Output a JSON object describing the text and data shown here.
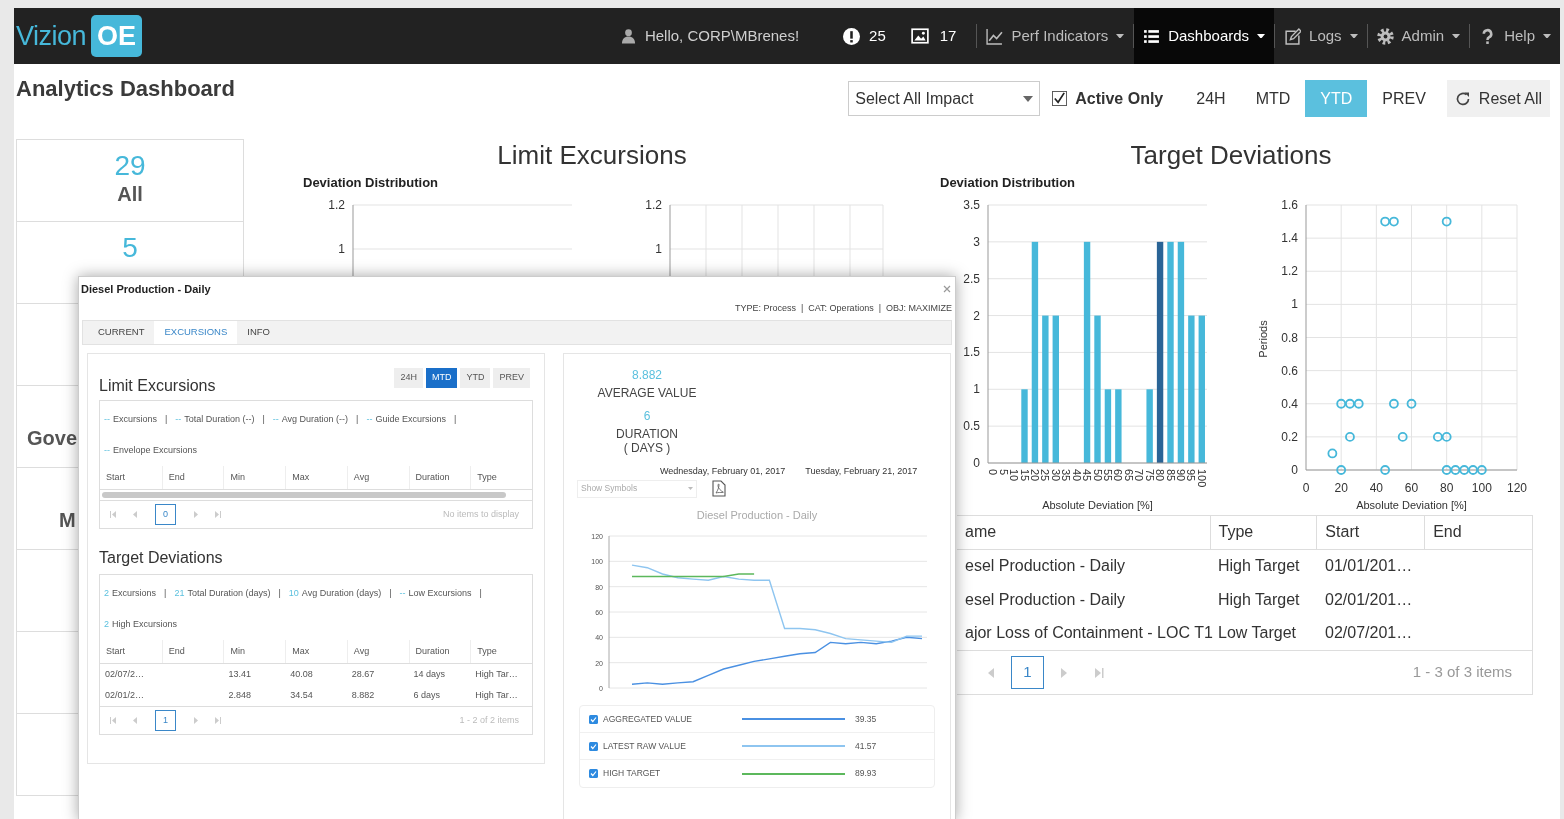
{
  "navbar": {
    "logo": {
      "text": "Vizion",
      "badge": "OE"
    },
    "greeting": "Hello, CORP\\MBrenes!",
    "alert_count": "25",
    "image_count": "17",
    "menus": [
      {
        "label": "Perf Indicators",
        "kind": "chart",
        "active": false
      },
      {
        "label": "Dashboards",
        "kind": "list",
        "active": true
      },
      {
        "label": "Logs",
        "kind": "edit",
        "active": false
      },
      {
        "label": "Admin",
        "kind": "gear",
        "active": false
      },
      {
        "label": "Help",
        "kind": "help",
        "active": false
      }
    ]
  },
  "page_title": "Analytics Dashboard",
  "filters": {
    "impact_select": "Select All Impact",
    "active_only": {
      "label": "Active Only",
      "checked": true
    },
    "ranges": [
      {
        "label": "24H",
        "selected": false
      },
      {
        "label": "MTD",
        "selected": false
      },
      {
        "label": "YTD",
        "selected": true
      },
      {
        "label": "PREV",
        "selected": false
      }
    ],
    "reset": "Reset All"
  },
  "kpi_cards": [
    {
      "count": "29",
      "label": "All"
    },
    {
      "count": "5"
    },
    {
      "label": "Gove"
    },
    {
      "label": "M"
    }
  ],
  "limit_excursions": {
    "title": "Limit Excursions",
    "distribution_chart": {
      "title": "Deviation Distribution",
      "y_tick_labels": [
        "1.2",
        "1"
      ]
    },
    "chart_2": {
      "y_tick_labels": [
        "1.2",
        "1"
      ]
    }
  },
  "target_deviations": {
    "title": "Target Deviations",
    "distribution_chart": {
      "chart_data": {
        "type": "bar",
        "title": "Deviation Distribution",
        "xlabel": "Absolute Deviation [%]",
        "categories": [
          "0",
          "5",
          "10",
          "15",
          "20",
          "25",
          "30",
          "35",
          "40",
          "45",
          "50",
          "55",
          "60",
          "65",
          "70",
          "75",
          "80",
          "85",
          "90",
          "95",
          "100"
        ],
        "series": [
          {
            "color": "#46b8da",
            "values": [
              0,
              0,
              0,
              1,
              3,
              2,
              2,
              0,
              0,
              3,
              2,
              1,
              1,
              0,
              0,
              1,
              null,
              3,
              3,
              2,
              2
            ]
          },
          {
            "color": "#2a6496",
            "values": [
              null,
              null,
              null,
              null,
              null,
              null,
              null,
              null,
              null,
              null,
              null,
              null,
              null,
              null,
              null,
              null,
              3,
              null,
              null,
              null,
              null
            ]
          }
        ],
        "stacked": true,
        "grid": true,
        "ylim": [
          0,
          3.5
        ],
        "yticks": [
          0,
          0.5,
          1,
          1.5,
          2,
          2.5,
          3,
          3.5
        ]
      }
    },
    "scatter_chart": {
      "chart_data": {
        "type": "scatter",
        "xlabel": "Absolute Deviation [%]",
        "ylabel": "Periods",
        "x": [
          45,
          50,
          80,
          20,
          25,
          30,
          50,
          60,
          25,
          55,
          75,
          80,
          15,
          20,
          45,
          80,
          85,
          90,
          95,
          100
        ],
        "series": [
          {
            "color": "#46b8da",
            "values": [
              1.5,
              1.5,
              1.5,
              0.4,
              0.4,
              0.4,
              0.4,
              0.4,
              0.2,
              0.2,
              0.2,
              0.2,
              0.1,
              0,
              0,
              0,
              0,
              0,
              0,
              0
            ]
          }
        ],
        "grid": true,
        "xlim": [
          0,
          120
        ],
        "ylim": [
          0,
          1.6
        ],
        "xticks": [
          0,
          20,
          40,
          60,
          80,
          100,
          120
        ],
        "yticks": [
          0,
          0.2,
          0.4,
          0.6,
          0.8,
          1,
          1.2,
          1.4,
          1.6
        ]
      }
    },
    "table": {
      "columns": [
        "ame",
        "Type",
        "Start",
        "End"
      ],
      "rows": [
        {
          "name": "esel Production - Daily",
          "type": "High Target",
          "start": "01/01/201…"
        },
        {
          "name": "esel Production - Daily",
          "type": "High Target",
          "start": "02/01/201…"
        },
        {
          "name": "ajor Loss of Containment - LOC T1",
          "type": "Low Target",
          "start": "02/07/201…"
        }
      ],
      "pager": {
        "page": "1",
        "summary": "1 - 3 of 3 items"
      }
    }
  },
  "modal": {
    "title": "Diesel Production - Daily",
    "meta": "TYPE: Process  |  CAT: Operations  |  OBJ: MAXIMIZE",
    "tabs": [
      {
        "label": "CURRENT",
        "selected": false
      },
      {
        "label": "EXCURSIONS",
        "selected": true
      },
      {
        "label": "INFO",
        "selected": false
      }
    ],
    "limit_panel": {
      "title": "Limit Excursions",
      "ranges": [
        {
          "label": "24H",
          "selected": false
        },
        {
          "label": "MTD",
          "selected": true
        },
        {
          "label": "YTD",
          "selected": false
        },
        {
          "label": "PREV",
          "selected": false
        }
      ],
      "stats": [
        {
          "value": "--",
          "label": "Excursions",
          "separator": "|"
        },
        {
          "value": "--",
          "label": "Total Duration (--)",
          "separator": "|"
        },
        {
          "value": "--",
          "label": "Avg Duration (--)",
          "separator": "|"
        },
        {
          "value": "--",
          "label": "Guide Excursions",
          "separator": "|"
        },
        {
          "value": "--",
          "label": "Envelope Excursions"
        }
      ],
      "table": {
        "columns": [
          "Start",
          "End",
          "Min",
          "Max",
          "Avg",
          "Duration",
          "Type"
        ],
        "pager": {
          "page": "0",
          "summary": "No items to display"
        }
      }
    },
    "target_panel": {
      "title": "Target Deviations",
      "stats": [
        {
          "value": "2",
          "label": "Excursions",
          "separator": "|"
        },
        {
          "value": "21",
          "label": "Total Duration (days)",
          "separator": "|"
        },
        {
          "value": "10",
          "label": "Avg Duration (days)",
          "separator": "|"
        },
        {
          "value": "--",
          "label": "Low Excursions",
          "separator": "|"
        },
        {
          "value": "2",
          "label": "High Excursions"
        }
      ],
      "table": {
        "columns": [
          "Start",
          "End",
          "Min",
          "Max",
          "Avg",
          "Duration",
          "Type"
        ],
        "rows": [
          {
            "start": "02/07/2…",
            "min": "13.41",
            "max": "40.08",
            "avg": "28.67",
            "duration": "14 days",
            "type": "High Tar…"
          },
          {
            "start": "02/01/2…",
            "min": "2.848",
            "max": "34.54",
            "avg": "8.882",
            "duration": "6 days",
            "type": "High Tar…"
          }
        ],
        "pager": {
          "page": "1",
          "summary": "1 - 2 of 2 items"
        }
      }
    },
    "detail_panel": {
      "average": {
        "value": "8.882",
        "label": "AVERAGE VALUE"
      },
      "duration": {
        "value": "6",
        "label_lines": [
          "DURATION",
          "( DAYS )"
        ]
      },
      "start_date": "Wednesday, February 01, 2017",
      "end_date": "Tuesday, February 21, 2017",
      "symbols_select": "Show Symbols",
      "chart_data": {
        "type": "line",
        "title": "Diesel Production - Daily",
        "grid": true,
        "ylim": [
          0,
          120
        ],
        "yticks": [
          0,
          20,
          40,
          60,
          80,
          100,
          120
        ],
        "series": [
          {
            "color": "#4a90e2",
            "values": [
              3,
              4,
              3,
              4,
              5,
              10,
              15,
              18,
              21,
              23,
              25,
              27,
              28,
              36,
              35,
              36,
              35,
              37,
              40,
              39
            ]
          },
          {
            "color": "#8ec5f0",
            "values": [
              97,
              95,
              90,
              87,
              86,
              85,
              88,
              86,
              85,
              85,
              47,
              47,
              46,
              43,
              39,
              38,
              37,
              36,
              41,
              41
            ]
          },
          {
            "color": "#5cb85c",
            "values": [
              88,
              88,
              88,
              88,
              88,
              88,
              88,
              90,
              90,
              null,
              null,
              null,
              null,
              null,
              null,
              null,
              null,
              null,
              null,
              null
            ]
          }
        ]
      },
      "legend": [
        {
          "label": "AGGREGATED VALUE",
          "checked": true,
          "color": "#4a90e2",
          "value": "39.35"
        },
        {
          "label": "LATEST RAW VALUE",
          "checked": true,
          "color": "#8ec5f0",
          "value": "41.57"
        },
        {
          "label": "HIGH TARGET",
          "checked": true,
          "color": "#5cb85c",
          "value": "89.93"
        }
      ]
    }
  }
}
